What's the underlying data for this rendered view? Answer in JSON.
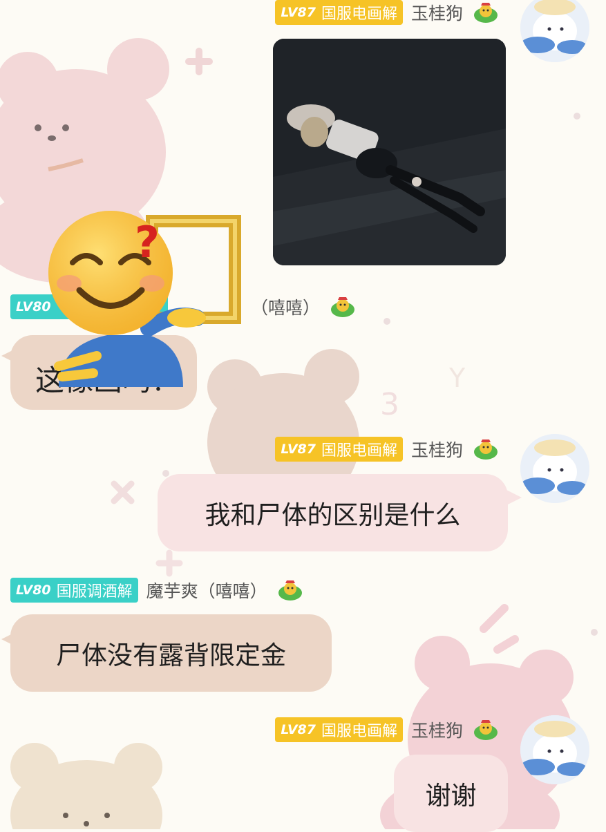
{
  "messages": [
    {
      "side": "right",
      "level": "LV87",
      "title": "国服电画解",
      "nickname": "玉桂狗",
      "type": "image",
      "image_desc": "dark-game-screenshot"
    },
    {
      "side": "left",
      "level": "LV80",
      "title": "国服调酒解",
      "nickname": "魔芋爽（嘻嘻）",
      "visible_nickname": "（嘻嘻）",
      "type": "text",
      "text": "这像画吗？"
    },
    {
      "side": "right",
      "level": "LV87",
      "title": "国服电画解",
      "nickname": "玉桂狗",
      "type": "text",
      "text": "我和尸体的区别是什么"
    },
    {
      "side": "left",
      "level": "LV80",
      "title": "国服调酒解",
      "nickname": "魔芋爽（嘻嘻）",
      "type": "text",
      "text": "尸体没有露背限定金"
    },
    {
      "side": "right",
      "level": "LV87",
      "title": "国服电画解",
      "nickname": "玉桂狗",
      "type": "text",
      "text": "谢谢"
    }
  ],
  "colors": {
    "gold_tag": "#f6c326",
    "teal_tag": "#3ad0c7",
    "pink_bubble": "#f8e3e3",
    "tan_bubble": "#ecd6c7",
    "background": "#fdfbf5"
  },
  "icons": [
    "green-frog-badge-icon",
    "avatar-cinnamoroll",
    "smiling-emoji-with-frame-sticker"
  ]
}
